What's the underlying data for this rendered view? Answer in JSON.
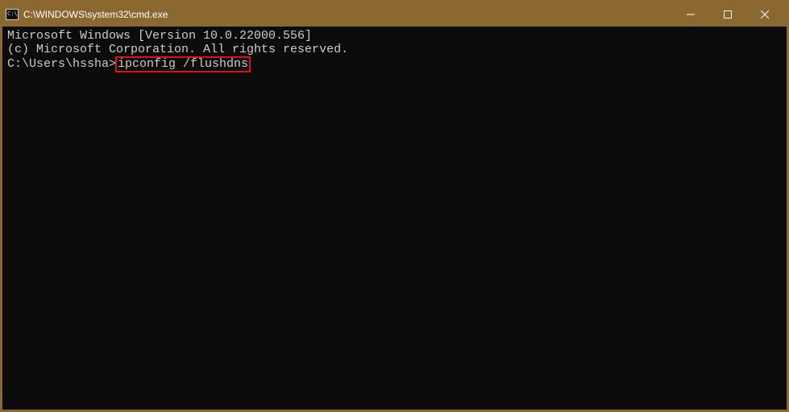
{
  "titlebar": {
    "title": "C:\\WINDOWS\\system32\\cmd.exe"
  },
  "terminal": {
    "line1": "Microsoft Windows [Version 10.0.22000.556]",
    "line2": "(c) Microsoft Corporation. All rights reserved.",
    "blank": "",
    "prompt": "C:\\Users\\hssha>",
    "command": "ipconfig /flushdns"
  }
}
